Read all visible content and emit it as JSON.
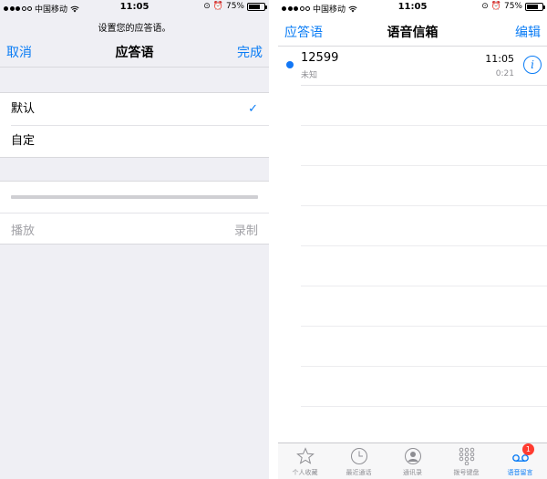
{
  "left": {
    "status": {
      "carrier": "中国移动",
      "time": "11:05",
      "battery": "75%",
      "battery_level": 0.75
    },
    "prompt": "设置您的应答语。",
    "nav": {
      "cancel": "取消",
      "title": "应答语",
      "done": "完成"
    },
    "options": [
      {
        "label": "默认",
        "selected": true,
        "check": "✓"
      },
      {
        "label": "自定",
        "selected": false
      }
    ],
    "playback": {
      "play": "播放",
      "record": "录制",
      "progress": 0
    }
  },
  "right": {
    "status": {
      "carrier": "中国移动",
      "time": "11:05",
      "battery": "75%",
      "battery_level": 0.75
    },
    "nav": {
      "greeting": "应答语",
      "title": "语音信箱",
      "edit": "编辑"
    },
    "voicemails": [
      {
        "number": "12599",
        "subtitle": "未知",
        "time": "11:05",
        "duration": "0:21",
        "unread": true,
        "info": "i"
      }
    ],
    "tabs": [
      {
        "label": "个人收藏",
        "icon": "star-icon"
      },
      {
        "label": "最近通话",
        "icon": "clock-icon"
      },
      {
        "label": "通讯录",
        "icon": "person-icon"
      },
      {
        "label": "拨号键盘",
        "icon": "keypad-icon"
      },
      {
        "label": "语音留言",
        "icon": "voicemail-icon",
        "badge": "1",
        "active": true
      }
    ]
  },
  "colors": {
    "accent": "#0a7cf5",
    "badge": "#ff3b30",
    "background": "#efeff4"
  }
}
